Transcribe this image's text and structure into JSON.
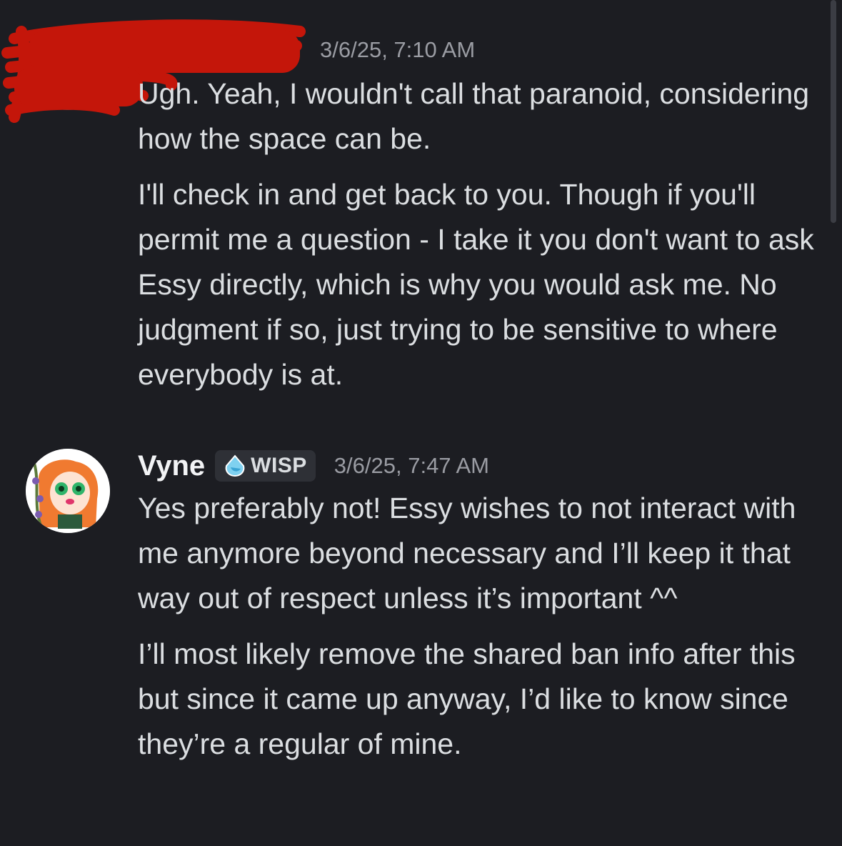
{
  "messages": [
    {
      "username": "",
      "timestamp": "3/6/25, 7:10 AM",
      "paragraphs": [
        "Ugh. Yeah, I wouldn't call that paranoid, considering how the space can be.",
        "I'll check in and get back to you. Though if you'll permit me a question - I take it you don't want to ask Essy directly, which is why you would ask me. No judgment if so, just trying to be sensitive to where everybody is at."
      ]
    },
    {
      "username": "Vyne",
      "tag": {
        "label": "WISP",
        "icon": "water-drop-icon",
        "color": "#5bc0e8"
      },
      "timestamp": "3/6/25, 7:47 AM",
      "paragraphs": [
        "Yes preferably not! Essy wishes to not interact with me anymore beyond necessary and I’ll keep it that way out of respect unless it’s important ^^",
        "I’ll most likely remove the shared ban info after this but since it came up anyway, I’d like to know since they’re a regular of mine."
      ]
    }
  ],
  "colors": {
    "background": "#1c1d22",
    "redaction": "#c4160a"
  }
}
